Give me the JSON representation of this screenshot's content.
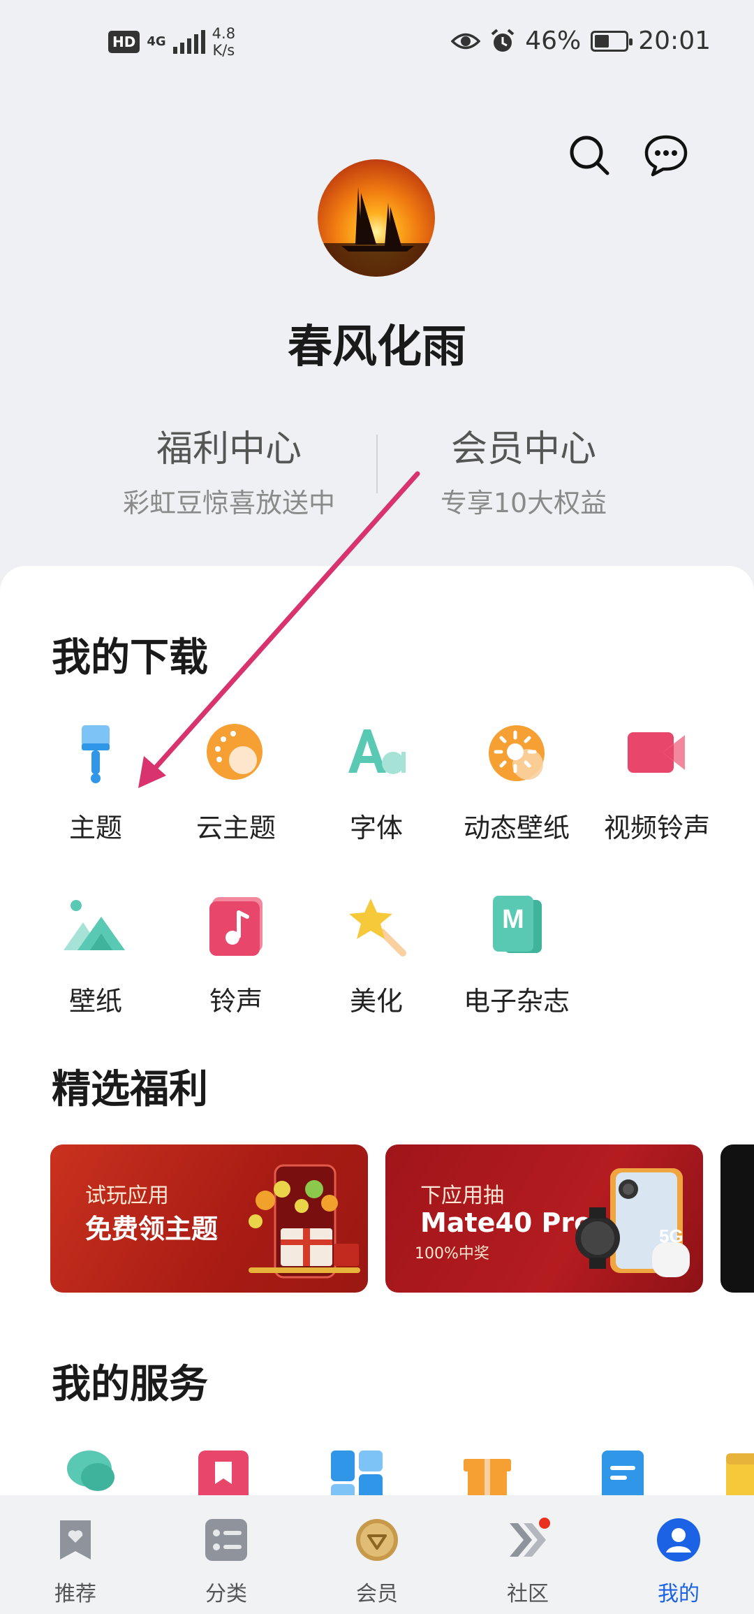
{
  "status_bar": {
    "hd": "HD",
    "network": "4G",
    "net_speed_value": "4.8",
    "net_speed_unit": "K/s",
    "battery": "46%",
    "battery_level": 0.46,
    "time": "20:01",
    "icons": [
      "eye-icon",
      "alarm-icon",
      "battery-icon"
    ]
  },
  "header": {
    "icons": [
      "search-icon",
      "message-icon"
    ],
    "username": "春风化雨"
  },
  "centers": [
    {
      "title": "福利中心",
      "subtitle": "彩虹豆惊喜放送中"
    },
    {
      "title": "会员中心",
      "subtitle": "专享10大权益"
    }
  ],
  "downloads": {
    "title": "我的下载",
    "items": [
      {
        "label": "主题",
        "icon": "paintbrush-icon"
      },
      {
        "label": "云主题",
        "icon": "cloud-theme-icon"
      },
      {
        "label": "字体",
        "icon": "font-icon"
      },
      {
        "label": "动态壁纸",
        "icon": "live-wallpaper-icon"
      },
      {
        "label": "视频铃声",
        "icon": "video-ringtone-icon"
      },
      {
        "label": "壁纸",
        "icon": "wallpaper-icon"
      },
      {
        "label": "铃声",
        "icon": "ringtone-icon"
      },
      {
        "label": "美化",
        "icon": "beautify-icon"
      },
      {
        "label": "电子杂志",
        "icon": "magazine-icon"
      }
    ]
  },
  "benefits": {
    "title": "精选福利",
    "banners": [
      {
        "line1": "试玩应用",
        "line2": "免费领主题"
      },
      {
        "line1": "下应用抽",
        "line2": "Mate40 Pro",
        "line3": "100%中奖"
      }
    ]
  },
  "services": {
    "title": "我的服务"
  },
  "bottom_nav": [
    {
      "label": "推荐",
      "icon": "recommend-icon"
    },
    {
      "label": "分类",
      "icon": "category-icon"
    },
    {
      "label": "会员",
      "icon": "member-icon"
    },
    {
      "label": "社区",
      "icon": "community-icon"
    },
    {
      "label": "我的",
      "icon": "profile-icon"
    }
  ],
  "colors": {
    "accent": "#1b62e5",
    "annotation_arrow": "#d8336f",
    "banner_red": "#b41c20"
  }
}
